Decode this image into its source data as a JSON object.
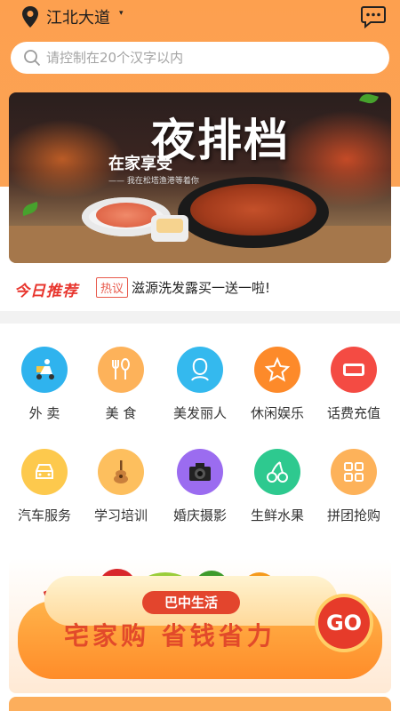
{
  "header": {
    "location": "江北大道",
    "caret": "▾",
    "search_placeholder": "请控制在20个汉字以内"
  },
  "banner": {
    "title": "夜排档",
    "subtitle": "在家享受",
    "tagline": "—— 我在松塔渔港等着你"
  },
  "news": {
    "logo": "今日推荐",
    "tag": "热议",
    "text": "滋源洗发露买一送一啦!"
  },
  "categories": [
    {
      "label": "外 卖",
      "color": "#2fb3ee",
      "icon": "delivery-icon"
    },
    {
      "label": "美 食",
      "color": "#fdb25a",
      "icon": "fork-spoon-icon"
    },
    {
      "label": "美发丽人",
      "color": "#34b9ee",
      "icon": "beauty-icon"
    },
    {
      "label": "休闲娱乐",
      "color": "#fd8a2a",
      "icon": "star-icon"
    },
    {
      "label": "话费充值",
      "color": "#f44b43",
      "icon": "discount-icon"
    },
    {
      "label": "汽车服务",
      "color": "#fdc94d",
      "icon": "car-icon"
    },
    {
      "label": "学习培训",
      "color": "#fdbf5e",
      "icon": "guitar-icon"
    },
    {
      "label": "婚庆摄影",
      "color": "#9b6cf0",
      "icon": "camera-icon"
    },
    {
      "label": "生鲜水果",
      "color": "#2ec98f",
      "icon": "cherry-icon"
    },
    {
      "label": "拼团抢购",
      "color": "#fdb25a",
      "icon": "grid-icon"
    }
  ],
  "promo": {
    "badge": "巴中生活",
    "title": "宅家购 省钱省力",
    "go": "GO"
  }
}
